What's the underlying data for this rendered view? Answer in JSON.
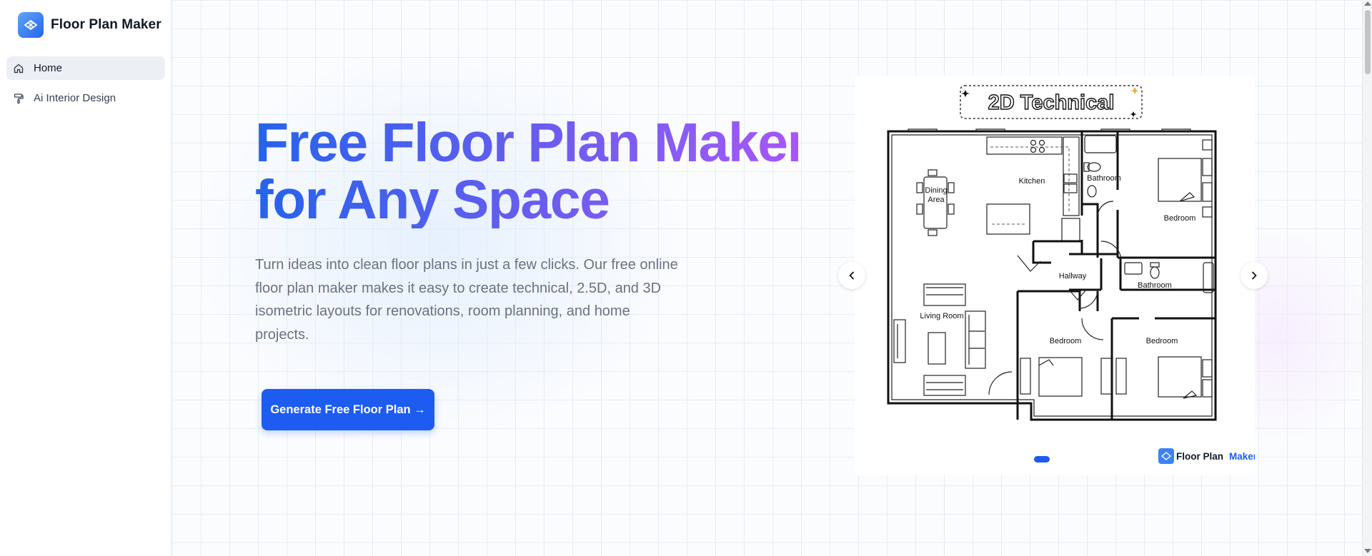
{
  "app": {
    "brand_name": "Floor Plan Maker"
  },
  "sidebar": {
    "items": [
      {
        "label": "Home",
        "icon": "home-icon",
        "active": true
      },
      {
        "label": "Ai Interior Design",
        "icon": "paint-roller-icon",
        "active": false
      }
    ]
  },
  "hero": {
    "title_line1": "Free Floor Plan Maker",
    "title_line2": "for Any Space",
    "description": "Turn ideas into clean floor plans in just a few clicks. Our free online floor plan maker makes it easy to create technical, 2.5D, and 3D isometric layouts for renovations, room planning, and home projects.",
    "cta_label": "Generate Free Floor Plan →"
  },
  "carousel": {
    "slide_title": "2D Technical",
    "watermark_part1": "Floor Plan",
    "watermark_part2": "Maker",
    "rooms": {
      "dining": "Dining",
      "dining2": "Area",
      "kitchen": "Kitchen",
      "bathroom_top": "Bathroom",
      "bedroom_top": "Bedroom",
      "hallway": "Hallway",
      "bathroom_mid": "Bathroom",
      "living": "Living Room",
      "bedroom_left": "Bedroom",
      "bedroom_right": "Bedroom"
    },
    "active_slide": 1,
    "slide_count": 1
  },
  "colors": {
    "accent": "#1d5cf0",
    "title_gradient_start": "#2563eb",
    "title_gradient_end": "#a855f7",
    "sidebar_active": "#eceff3",
    "body_text": "#6b7280"
  }
}
